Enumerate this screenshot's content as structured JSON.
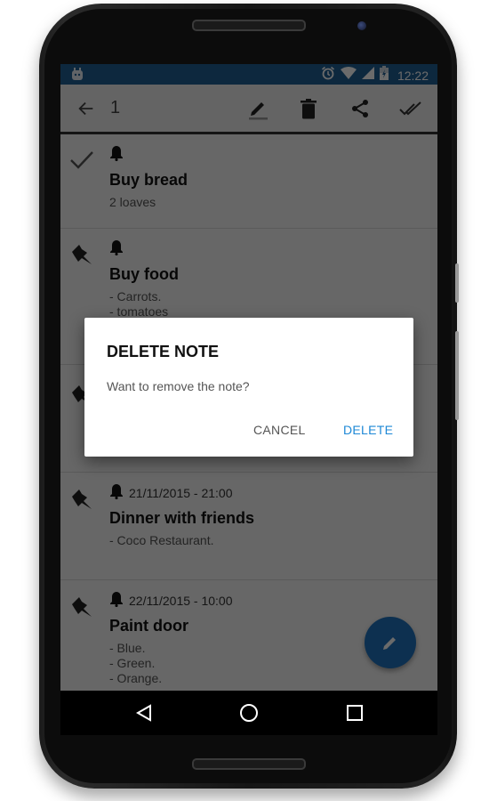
{
  "status_bar": {
    "app_icon": "android-debug-icon",
    "icons": [
      "alarm-icon",
      "wifi-icon",
      "cell-signal-icon",
      "battery-charging-icon"
    ],
    "time": "12:22",
    "background": "#1f5f94"
  },
  "toolbar": {
    "back_icon": "arrow-back-icon",
    "selected_count": "1",
    "actions": [
      {
        "name": "edit",
        "icon": "pencil-icon"
      },
      {
        "name": "delete",
        "icon": "trash-icon"
      },
      {
        "name": "share",
        "icon": "share-icon"
      },
      {
        "name": "mark-done",
        "icon": "double-check-icon"
      }
    ]
  },
  "notes": [
    {
      "status_icon": "check-icon",
      "reminder": "",
      "title": "Buy bread",
      "text": "2 loaves"
    },
    {
      "status_icon": "pin-icon",
      "reminder": "",
      "title": "Buy food",
      "text": "- Carrots.\n- tomatoes"
    },
    {
      "status_icon": "pin-icon",
      "reminder": "",
      "title": "",
      "text": ""
    },
    {
      "status_icon": "pin-icon",
      "reminder": "21/11/2015 - 21:00",
      "title": "Dinner with friends",
      "text": "- Coco Restaurant."
    },
    {
      "status_icon": "pin-icon",
      "reminder": "22/11/2015 - 10:00",
      "title": "Paint door",
      "text": "- Blue.\n- Green.\n- Orange."
    }
  ],
  "fab": {
    "icon": "pencil-icon",
    "color": "#1f74bf"
  },
  "dialog": {
    "title": "DELETE NOTE",
    "message": "Want to remove the note?",
    "cancel_label": "CANCEL",
    "confirm_label": "DELETE",
    "accent": "#1e88d6"
  },
  "nav_bar": {
    "buttons": [
      "back-icon",
      "home-icon",
      "recents-icon"
    ]
  }
}
